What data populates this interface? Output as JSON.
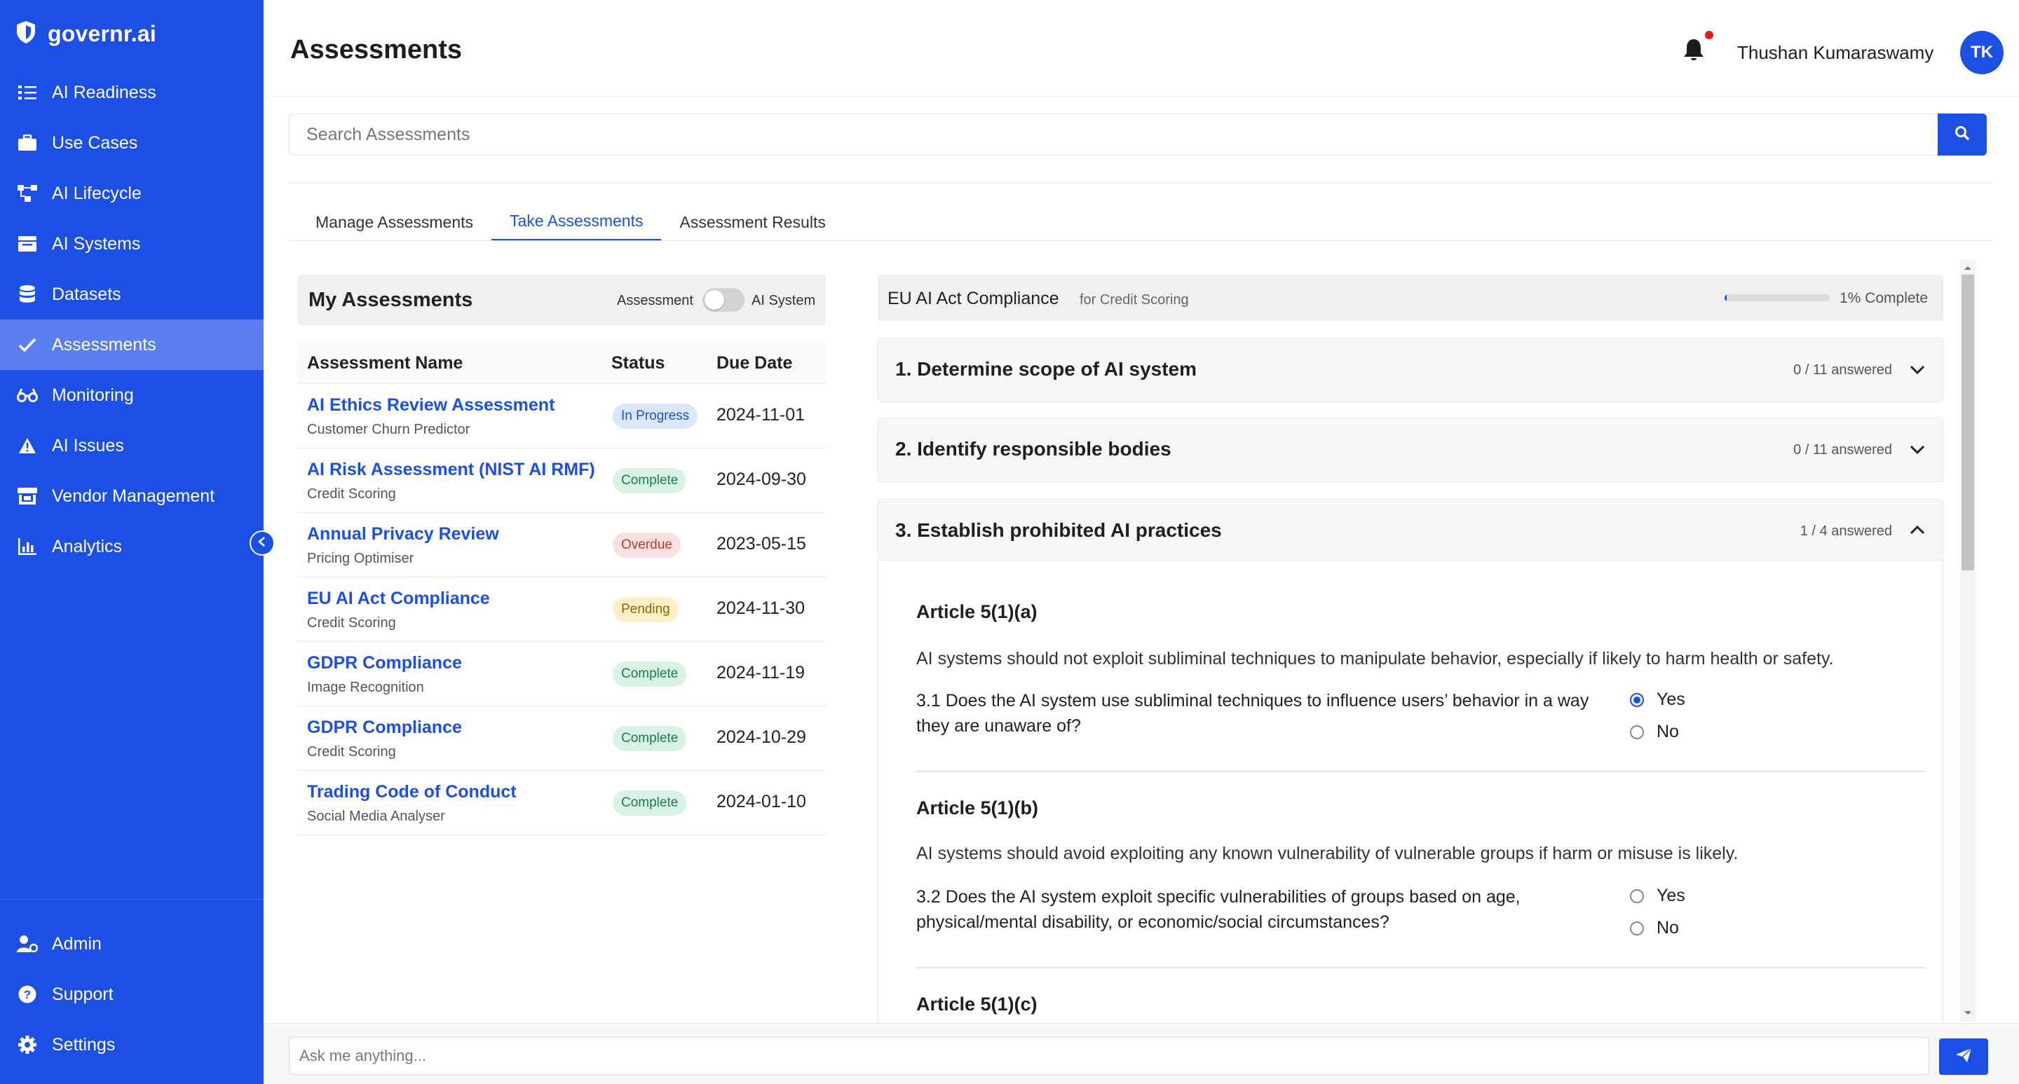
{
  "app": {
    "brand": "governr.ai",
    "accent": "#1c4fe3"
  },
  "sidebar": {
    "items": [
      {
        "label": "AI Readiness",
        "icon": "checklist-icon"
      },
      {
        "label": "Use Cases",
        "icon": "briefcase-icon"
      },
      {
        "label": "AI Lifecycle",
        "icon": "flow-icon"
      },
      {
        "label": "AI Systems",
        "icon": "server-icon"
      },
      {
        "label": "Datasets",
        "icon": "database-icon"
      },
      {
        "label": "Assessments",
        "icon": "check-icon"
      },
      {
        "label": "Monitoring",
        "icon": "binoculars-icon"
      },
      {
        "label": "AI Issues",
        "icon": "warning-icon"
      },
      {
        "label": "Vendor Management",
        "icon": "store-icon"
      },
      {
        "label": "Analytics",
        "icon": "chart-icon"
      }
    ],
    "bottom": [
      {
        "label": "Admin",
        "icon": "user-gear-icon"
      },
      {
        "label": "Support",
        "icon": "question-icon"
      },
      {
        "label": "Settings",
        "icon": "gear-icon"
      }
    ]
  },
  "header": {
    "title": "Assessments",
    "user_name": "Thushan Kumaraswamy",
    "avatar_initials": "TK"
  },
  "search": {
    "placeholder": "Search Assessments"
  },
  "tabs": [
    {
      "label": "Manage Assessments"
    },
    {
      "label": "Take Assessments",
      "active": true
    },
    {
      "label": "Assessment Results"
    }
  ],
  "my_assessments": {
    "title": "My Assessments",
    "toggle_left": "Assessment",
    "toggle_right": "AI System",
    "columns": [
      "Assessment Name",
      "Status",
      "Due Date"
    ],
    "rows": [
      {
        "name": "AI Ethics Review Assessment",
        "system": "Customer Churn Predictor",
        "status": "In Progress",
        "due": "2024-11-01"
      },
      {
        "name": "AI Risk Assessment (NIST AI RMF)",
        "system": "Credit Scoring",
        "status": "Complete",
        "due": "2024-09-30"
      },
      {
        "name": "Annual Privacy Review",
        "system": "Pricing Optimiser",
        "status": "Overdue",
        "due": "2023-05-15"
      },
      {
        "name": "EU AI Act Compliance",
        "system": "Credit Scoring",
        "status": "Pending",
        "due": "2024-11-30"
      },
      {
        "name": "GDPR Compliance",
        "system": "Image Recognition",
        "status": "Complete",
        "due": "2024-11-19"
      },
      {
        "name": "GDPR Compliance",
        "system": "Credit Scoring",
        "status": "Complete",
        "due": "2024-10-29"
      },
      {
        "name": "Trading Code of Conduct",
        "system": "Social Media Analyser",
        "status": "Complete",
        "due": "2024-01-10"
      }
    ]
  },
  "assessment": {
    "title": "EU AI Act Compliance",
    "subtitle": "for Credit Scoring",
    "progress_fraction": 0.01,
    "progress_text": "1% Complete",
    "sections": [
      {
        "title": "1. Determine scope of AI system",
        "count": "0 / 11 answered",
        "expanded": false
      },
      {
        "title": "2. Identify responsible bodies",
        "count": "0 / 11 answered",
        "expanded": false
      },
      {
        "title": "3. Establish prohibited AI practices",
        "count": "1 / 4 answered",
        "expanded": true
      }
    ],
    "articles": [
      {
        "title": "Article 5(1)(a)",
        "desc": "AI systems should not exploit subliminal techniques to manipulate behavior, especially if likely to harm health or safety.",
        "question": "3.1 Does the AI system use subliminal techniques to influence users’ behavior in a way they are unaware of?",
        "options": [
          "Yes",
          "No"
        ],
        "selected": "Yes"
      },
      {
        "title": "Article 5(1)(b)",
        "desc": "AI systems should avoid exploiting any known vulnerability of vulnerable groups if harm or misuse is likely.",
        "question": "3.2 Does the AI system exploit specific vulnerabilities of groups based on age, physical/mental disability, or economic/social circumstances?",
        "options": [
          "Yes",
          "No"
        ],
        "selected": ""
      },
      {
        "title": "Article 5(1)(c)"
      }
    ]
  },
  "chat": {
    "placeholder": "Ask me anything..."
  }
}
